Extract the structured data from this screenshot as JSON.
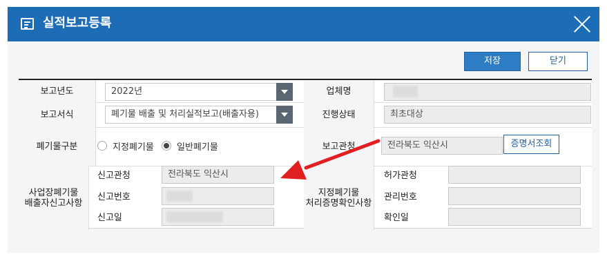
{
  "dialog": {
    "title": "실적보고등록",
    "icon": "form-icon",
    "close_icon": "close-icon"
  },
  "toolbar": {
    "save_label": "저장",
    "close_label": "닫기"
  },
  "form": {
    "report_year": {
      "label": "보고년도",
      "value": "2022년"
    },
    "report_format": {
      "label": "보고서식",
      "value": "폐기물 배출 및 처리실적보고(배출자용)"
    },
    "company_name": {
      "label": "업체명",
      "value": ""
    },
    "progress_status": {
      "label": "진행상태",
      "value": "최초대상"
    },
    "waste_type": {
      "label": "폐기물구분",
      "options": [
        "지정폐기물",
        "일반폐기물"
      ],
      "selected": "일반폐기물"
    },
    "report_authority": {
      "label": "보고관청",
      "value": "전라북도 익산시",
      "button": "증명서조회"
    },
    "discharger_report": {
      "label_line1": "사업장폐기물",
      "label_line2": "배출자신고사항",
      "authority_label": "신고관청",
      "authority_value": "전라북도 익산시",
      "number_label": "신고번호",
      "number_value": "",
      "date_label": "신고일",
      "date_value": ""
    },
    "treatment_cert": {
      "label_line1": "지정폐기물",
      "label_line2": "처리증명확인사항",
      "permit_label": "허가관청",
      "permit_value": "",
      "manage_label": "관리번호",
      "manage_value": "",
      "confirm_label": "확인일",
      "confirm_value": ""
    }
  },
  "colors": {
    "titlebar": "#1c6cb6",
    "primary_button": "#2e7cc4",
    "arrow_annotation": "#e02020"
  }
}
